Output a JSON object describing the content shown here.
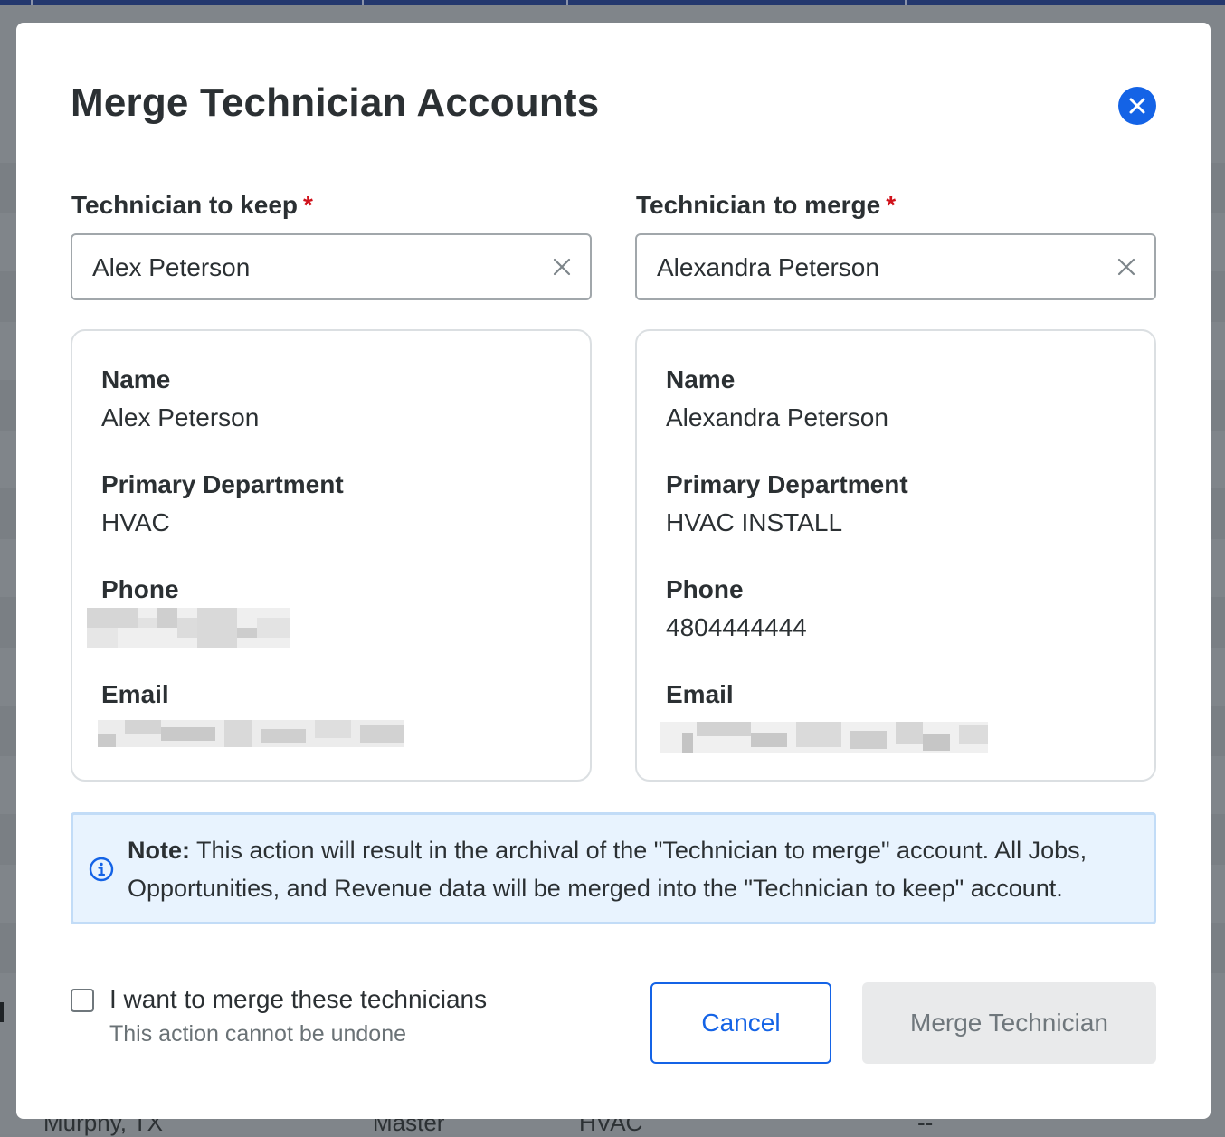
{
  "background": {
    "row_cells": [
      "Murphy, TX",
      "Master",
      "HVAC",
      "--"
    ]
  },
  "modal": {
    "title": "Merge Technician Accounts",
    "close_icon": "close-icon",
    "keep": {
      "label": "Technician to keep",
      "required_mark": "*",
      "selected": "Alex Peterson",
      "details": {
        "name_label": "Name",
        "name": "Alex Peterson",
        "department_label": "Primary Department",
        "department": "HVAC",
        "phone_label": "Phone",
        "email_label": "Email"
      }
    },
    "merge": {
      "label": "Technician to merge",
      "required_mark": "*",
      "selected": "Alexandra Peterson",
      "details": {
        "name_label": "Name",
        "name": "Alexandra Peterson",
        "department_label": "Primary Department",
        "department": "HVAC INSTALL",
        "phone_label": "Phone",
        "phone": "4804444444",
        "email_label": "Email"
      }
    },
    "note": {
      "icon": "info-icon",
      "lead": "Note:",
      "text": " This action will result in the archival of the \"Technician to merge\" account. All Jobs, Opportunities, and Revenue data will be merged into the \"Technician to keep\" account."
    },
    "confirm": {
      "label": "I want to merge these technicians",
      "sublabel": "This action cannot be undone",
      "checked": false
    },
    "buttons": {
      "cancel": "Cancel",
      "merge": "Merge Technician"
    },
    "colors": {
      "accent": "#1463e6",
      "required": "#d0121b",
      "note_bg": "#e8f3fe",
      "disabled_bg": "#e9eaeb"
    }
  }
}
